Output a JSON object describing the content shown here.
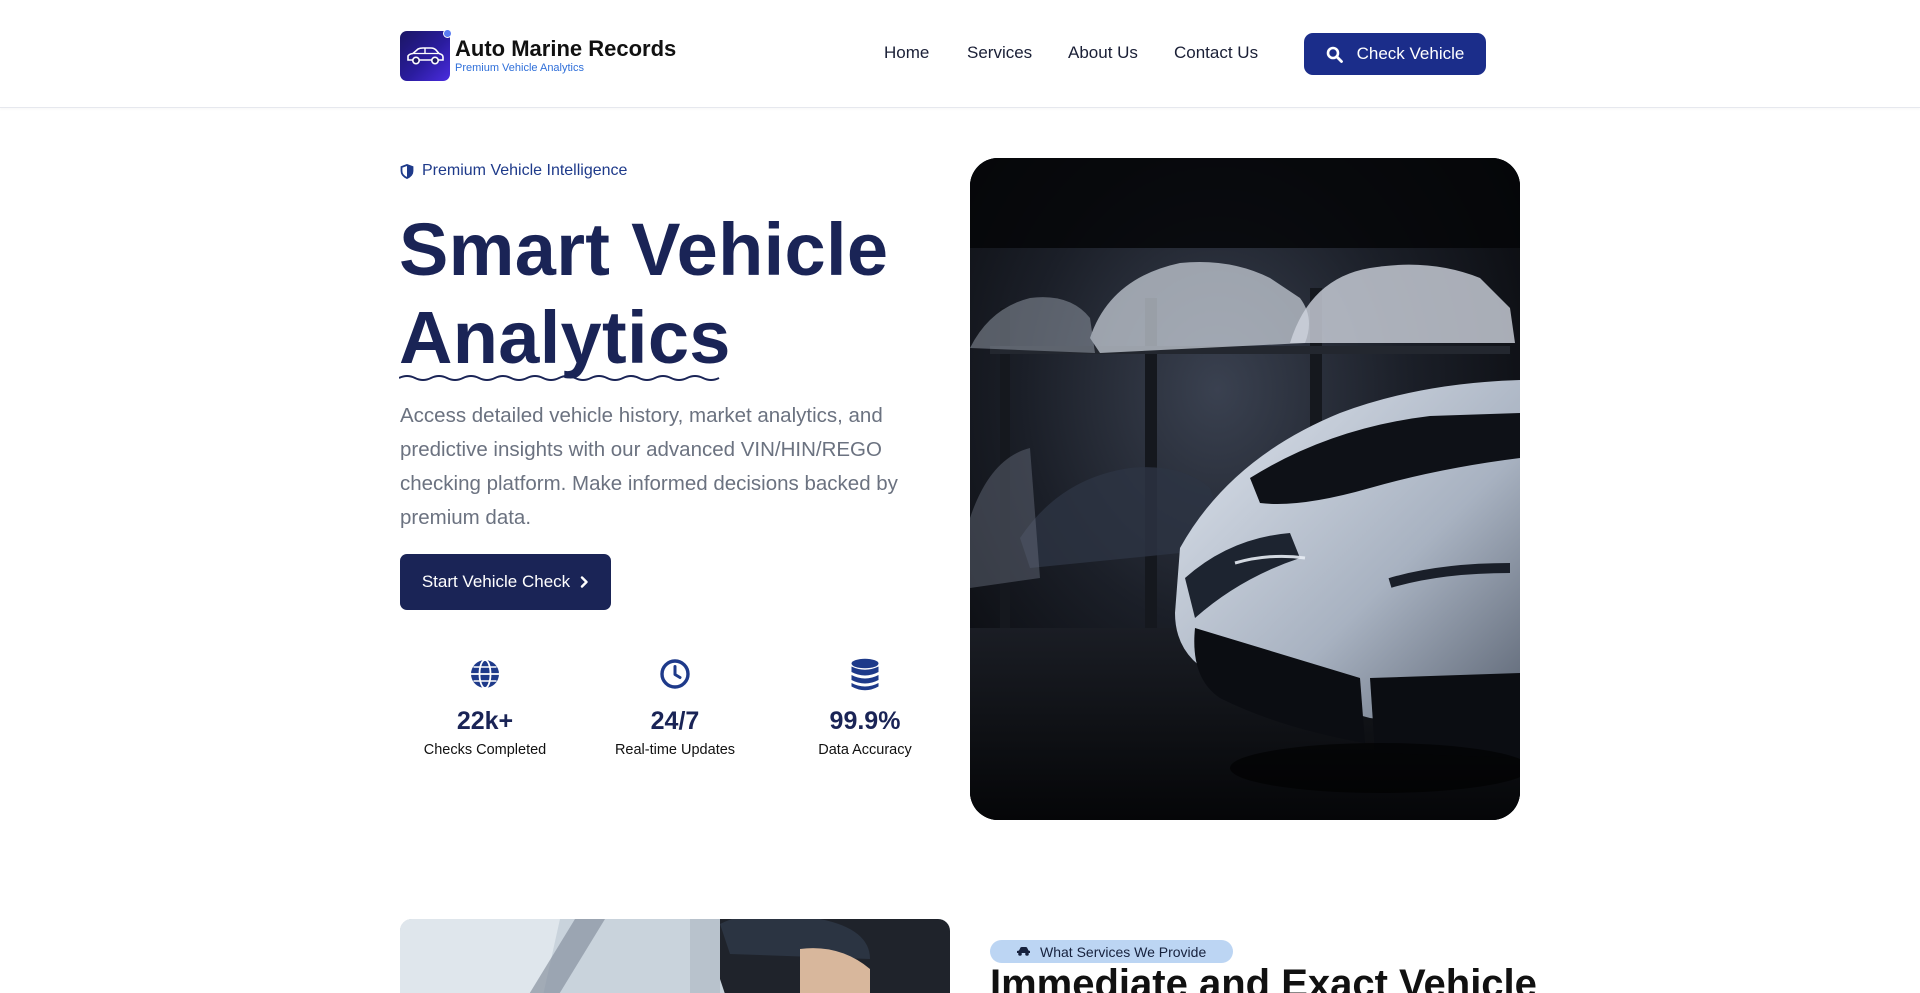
{
  "header": {
    "logo_title": "Auto Marine Records",
    "logo_subtitle": "Premium Vehicle Analytics",
    "nav": [
      {
        "label": "Home"
      },
      {
        "label": "Services"
      },
      {
        "label": "About Us"
      },
      {
        "label": "Contact Us"
      }
    ],
    "check_button": "Check Vehicle",
    "check_icon": "search-icon"
  },
  "hero": {
    "badge": "Premium Vehicle Intelligence",
    "badge_icon": "shield-icon",
    "title_line1": "Smart Vehicle",
    "title_line2": "Analytics",
    "description": "Access detailed vehicle history, market analytics, and predictive insights with our advanced VIN/HIN/REGO checking platform. Make informed decisions backed by premium data.",
    "cta": "Start Vehicle Check",
    "stats": [
      {
        "icon": "globe-icon",
        "value": "22k+",
        "label": "Checks Completed"
      },
      {
        "icon": "clock-icon",
        "value": "24/7",
        "label": "Real-time Updates"
      },
      {
        "icon": "database-icon",
        "value": "99.9%",
        "label": "Data Accuracy"
      }
    ]
  },
  "services": {
    "pill": "What Services We Provide",
    "pill_icon": "car-icon",
    "title": "Immediate and Exact Vehicle"
  },
  "colors": {
    "primary": "#1a2456",
    "accent": "#1b2d8a",
    "badge_text": "#1e3a8a",
    "pill_bg": "#bcd5f3"
  }
}
